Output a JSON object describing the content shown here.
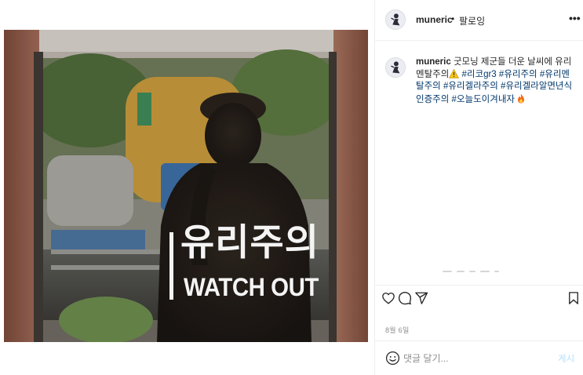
{
  "header": {
    "username": "muneric",
    "separator": "•",
    "follow_label": "팔로잉",
    "more_icon": "more-options-icon",
    "more_label": "•••"
  },
  "caption": {
    "username": "muneric",
    "text_1": "굿모닝 제군들 더운 날씨에 유리멘탈주의",
    "hashtags": [
      "#리코gr3",
      "#유리주의",
      "#유리멘탈주의",
      "#유리겔라주의",
      "#유리겔라알면년식인증주의",
      "#오늘도이겨내자"
    ],
    "emoji_warning": "warning-emoji",
    "emoji_fire": "fire-emoji"
  },
  "photo": {
    "sticker_korean": "유리주의",
    "sticker_english": "WATCH OUT"
  },
  "actions": {
    "like_icon": "heart-icon",
    "comment_icon": "comment-icon",
    "share_icon": "share-icon",
    "save_icon": "bookmark-icon"
  },
  "date": "8월 6일",
  "comment_box": {
    "placeholder": "댓글 달기...",
    "emoji_icon": "smiley-icon",
    "post_label": "게시",
    "post_color": "#b2dffc"
  },
  "colors": {
    "hashtag": "#00376b",
    "text": "#262626",
    "muted": "#8e8e8e",
    "border": "#efefef"
  }
}
